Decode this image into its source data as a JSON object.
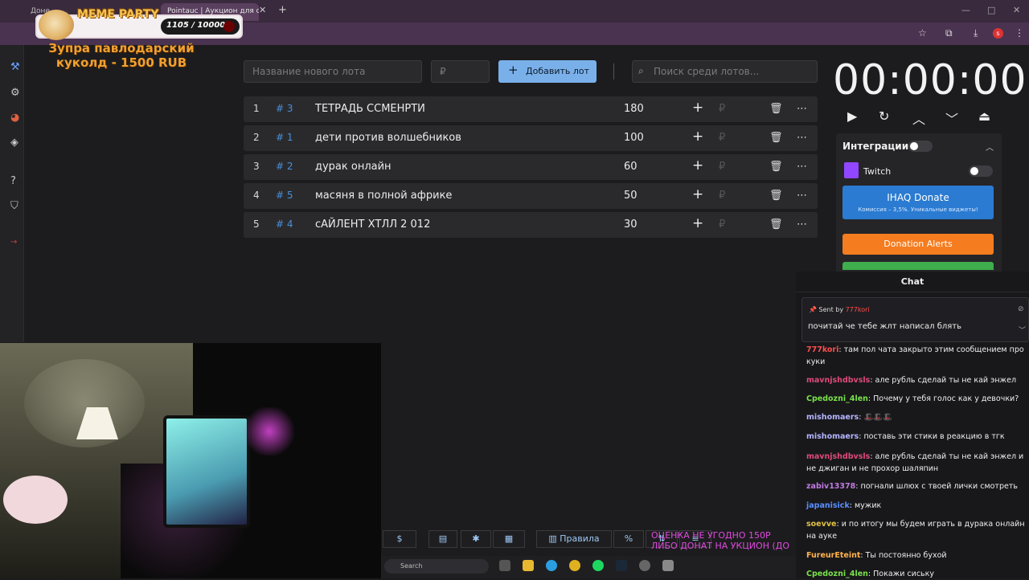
{
  "browser": {
    "tabs": [
      "Доне",
      "Pointauc | Аукцион для стрим"
    ],
    "controls": [
      "—",
      "□",
      "✕"
    ]
  },
  "meme": {
    "title": "MEME PARTY",
    "count": "1105 / 10000"
  },
  "lot_banner": "Зупра павлодарский куколд - 1500 RUB",
  "controls": {
    "new_lot_placeholder": "Название нового лота",
    "amount_placeholder": "₽",
    "add_button": "Добавить лот",
    "search_placeholder": "Поиск среди лотов..."
  },
  "lots": [
    {
      "index": "1",
      "id": "# 3",
      "name": "ТЕТРАДЬ ССМЕНРТИ",
      "amount": "180"
    },
    {
      "index": "2",
      "id": "# 1",
      "name": "дети против волшебников",
      "amount": "100"
    },
    {
      "index": "3",
      "id": "# 2",
      "name": "дурак онлайн",
      "amount": "60"
    },
    {
      "index": "4",
      "id": "# 5",
      "name": "масяня в полной африке",
      "amount": "50"
    },
    {
      "index": "5",
      "id": "# 4",
      "name": "сАЙЛЕНТ ХТЛЛ 2 012",
      "amount": "30"
    }
  ],
  "row_icons": {
    "plus": "+",
    "rub": "₽",
    "delete": "🗑",
    "more": "⋯"
  },
  "timer": {
    "display": "00:00:00"
  },
  "integrations": {
    "title": "Интеграции",
    "twitch": "Twitch",
    "donate_title": "IHAQ Donate",
    "donate_sub": "Комиссия – 3,5%. Уникальные виджеты!",
    "donation_alerts": "Donation Alerts"
  },
  "toolbar": {
    "rules": "Правила",
    "percent": "%",
    "pink_line1": "ОЦЕНКА НЕ УГОДНО 150Р",
    "pink_line2": "ЛИБО ДОНАТ НА УКЦИОН (ДО"
  },
  "taskbar": {
    "search": "Search"
  },
  "chat": {
    "title": "Chat",
    "pinned_by_prefix": "Sent by",
    "pinned_user": "777kori",
    "pinned_msg": "почитай че тебе жлт написал блять",
    "messages": [
      {
        "user": "777kori",
        "color": "#ff4e4e",
        "text": "там пол чата закрыто этим сообщением про куки"
      },
      {
        "user": "mavnjshdbvsls",
        "color": "#e04a7a",
        "text": "але рубль сделай ты не кай энжел"
      },
      {
        "user": "Cpedozni_4len",
        "color": "#7ae04a",
        "text": "Почему у тебя голос как у девочки?"
      },
      {
        "user": "mishomaers",
        "color": "#b4b4ff",
        "text": "🎩🎩🎩"
      },
      {
        "user": "mishomaers",
        "color": "#b4b4ff",
        "text": "поставь эти стики в реакцию в тгк"
      },
      {
        "user": "mavnjshdbvsls",
        "color": "#e04a7a",
        "text": "але рубль сделай ты не кай энжел и не джиган и не прохор шаляпин"
      },
      {
        "user": "zabiv13378",
        "color": "#c07ae0",
        "text": "погнали шлюх с твоей лички смотреть"
      },
      {
        "user": "japanisick",
        "color": "#5a8fff",
        "text": "мужик"
      },
      {
        "user": "soevve",
        "color": "#e0c040",
        "text": "и по итогу мы будем играть в дурака онлайн на ауке"
      },
      {
        "user": "FureurEteint",
        "color": "#ffb24a",
        "text": "Ты постоянно бухой"
      },
      {
        "user": "Cpedozni_4len",
        "color": "#7ae04a",
        "text": "Покажи сиську"
      }
    ]
  }
}
